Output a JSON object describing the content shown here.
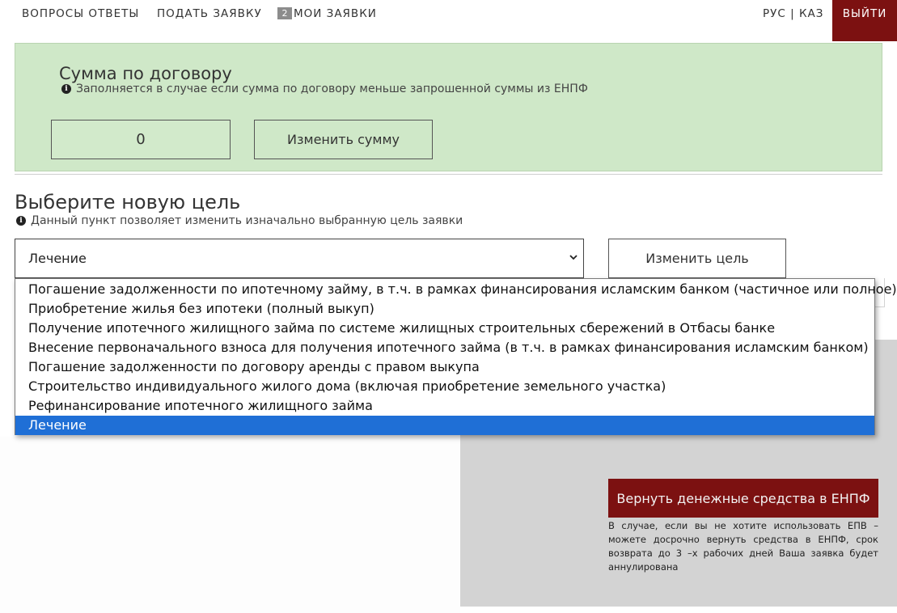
{
  "nav": {
    "faq": "ВОПРОСЫ ОТВЕТЫ",
    "apply": "ПОДАТЬ ЗАЯВКУ",
    "my_requests_count": "2",
    "my_requests": "МОИ ЗАЯВКИ",
    "lang_ru": "РУС",
    "lang_sep": "|",
    "lang_kz": "КАЗ",
    "logout": "ВЫЙТИ"
  },
  "contract_sum": {
    "title": "Сумма по договору",
    "hint": "Заполняется в случае если сумма по договору меньше запрошенной суммы из ЕНПФ",
    "value": "0",
    "change_button": "Изменить сумму",
    "panel_color": "#cfe8c8"
  },
  "new_goal": {
    "title": "Выберите новую цель",
    "hint": "Данный пункт позволяет изменить изначально выбранную цель заявки",
    "selected_value": "Лечение",
    "change_button": "Изменить цель",
    "options": [
      "Погашение задолженности по ипотечному займу, в т.ч. в рамках финансирования исламским банком (частичное или полное)",
      "Приобретение жилья без ипотеки (полный выкуп)",
      "Получение ипотечного жилищного займа по системе жилищных строительных сбережений в Отбасы банке",
      "Внесение первоначального взноса для получения ипотечного займа (в т.ч. в рамках финансирования исламским банком)",
      "Погашение задолженности по договору аренды с правом выкупа",
      "Строительство индивидуального жилого дома (включая приобретение земельного участка)",
      "Рефинансирование ипотечного жилищного займа",
      "Лечение"
    ],
    "selected_index": 7,
    "highlight_color": "#1f6fd6"
  },
  "return_funds": {
    "button": "Вернуть денежные средства в ЕНПФ",
    "note": "В случае, если вы не хотите использовать ЕПВ – можете досрочно вернуть средства в ЕНПФ, срок возврата до 3 –х рабочих дней Ваша заявка будет аннулирована",
    "button_color": "#7c1111"
  },
  "icons": {
    "info": "info-icon",
    "dropdown": "chevron-down-icon"
  }
}
